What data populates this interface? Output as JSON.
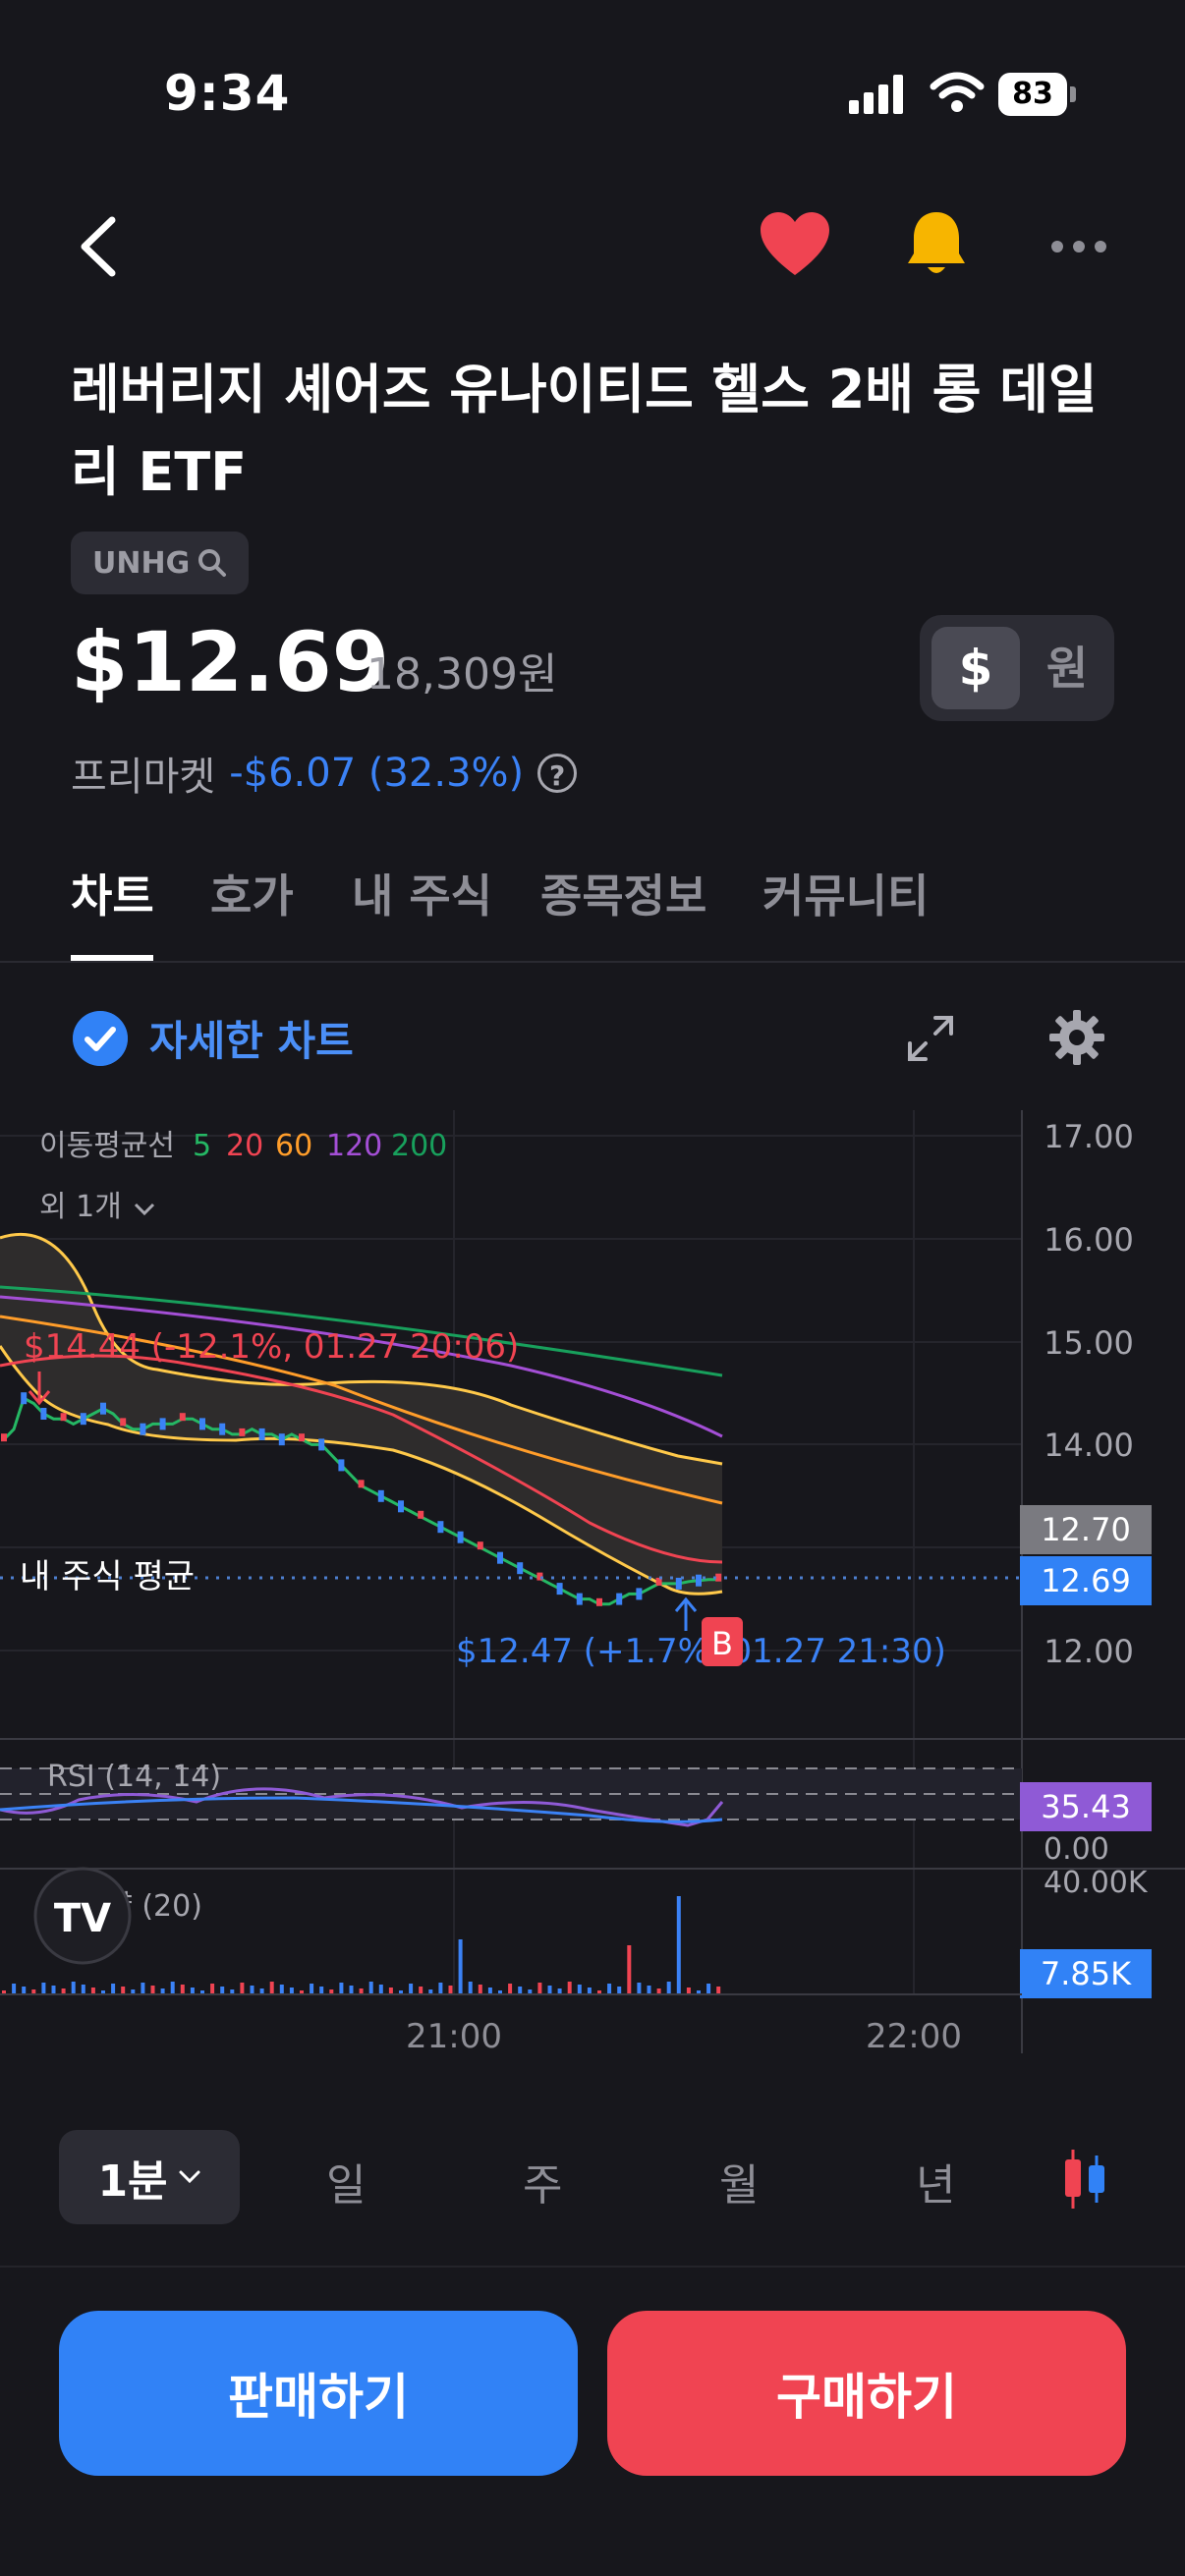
{
  "status_bar": {
    "time": "9:34",
    "battery": "83"
  },
  "header": {
    "title": "레버리지 셰어즈 유나이티드 헬스 2배 롱 데일리 ETF",
    "ticker": "UNHG",
    "price": "$12.69",
    "price_krw": "18,309원",
    "currency_options": [
      "$",
      "원"
    ],
    "premarket_label": "프리마켓",
    "premarket_change": "-$6.07 (32.3%)",
    "help_glyph": "?"
  },
  "tabs": [
    "차트",
    "호가",
    "내 주식",
    "종목정보",
    "커뮤니티"
  ],
  "chart_toolbar": {
    "detail_label": "자세한 차트"
  },
  "chart": {
    "ma_label": "이동평균선",
    "ma_periods": [
      "5",
      "20",
      "60",
      "120",
      "200"
    ],
    "ma_colors": [
      "#25b864",
      "#f04452",
      "#ff9d2a",
      "#a44fd6",
      "#18a05c"
    ],
    "more_label": "외 1개",
    "y_ticks": [
      "17.00",
      "16.00",
      "15.00",
      "14.00",
      "12.00"
    ],
    "current_price_tag": "12.69",
    "prev_tag": "12.70",
    "avg_label": "내 주식 평균",
    "high_annotation": "$14.44 (-12.1%, 01.27 20:06)",
    "low_annotation": "$12.47 (+1.7%, 01.27 21:30)",
    "buy_marker": "B",
    "rsi_label": "RSI (14, 14)",
    "rsi_value": "35.43",
    "rsi_zero": "0.00",
    "volume_label": "거래량 (20)",
    "volume_max": "40.00K",
    "volume_value": "7.85K",
    "x_ticks": [
      "21:00",
      "22:00"
    ],
    "logo": "TV"
  },
  "chart_data": {
    "type": "line",
    "ylim": [
      11.6,
      17.2
    ],
    "x": [
      0,
      1,
      2,
      3,
      4,
      5,
      6,
      7,
      8,
      9,
      10,
      11,
      12,
      13,
      14,
      15,
      16,
      17,
      18,
      19,
      20,
      21,
      22,
      23,
      24,
      25,
      26,
      27,
      28,
      29,
      30,
      31,
      32,
      33,
      34,
      35,
      36,
      37,
      38,
      39,
      40,
      41,
      42,
      43,
      44,
      45,
      46,
      47,
      48,
      49,
      50,
      51,
      52,
      53,
      54,
      55,
      56,
      57,
      58,
      59,
      60,
      61,
      62,
      63,
      64,
      65,
      66,
      67,
      68,
      69,
      70,
      71,
      72
    ],
    "series": [
      {
        "name": "5",
        "values": [
          14.05,
          14.15,
          14.45,
          14.4,
          14.3,
          14.25,
          14.25,
          14.2,
          14.25,
          14.3,
          14.35,
          14.3,
          14.2,
          14.15,
          14.15,
          14.2,
          14.2,
          14.2,
          14.25,
          14.25,
          14.2,
          14.15,
          14.15,
          14.1,
          14.1,
          14.15,
          14.1,
          14.1,
          14.05,
          14.1,
          14.05,
          14.0,
          14.0,
          13.9,
          13.8,
          13.7,
          13.6,
          13.55,
          13.5,
          13.45,
          13.4,
          13.35,
          13.3,
          13.25,
          13.2,
          13.15,
          13.1,
          13.05,
          13.0,
          12.95,
          12.9,
          12.85,
          12.8,
          12.75,
          12.7,
          12.65,
          12.6,
          12.55,
          12.5,
          12.5,
          12.45,
          12.45,
          12.5,
          12.55,
          12.55,
          12.6,
          12.65,
          12.65,
          12.65,
          12.67,
          12.68,
          12.69,
          12.69
        ]
      }
    ]
  },
  "periods": {
    "selected": "1분",
    "options": [
      "일",
      "주",
      "월",
      "년"
    ]
  },
  "actions": {
    "sell": "판매하기",
    "buy": "구매하기"
  }
}
